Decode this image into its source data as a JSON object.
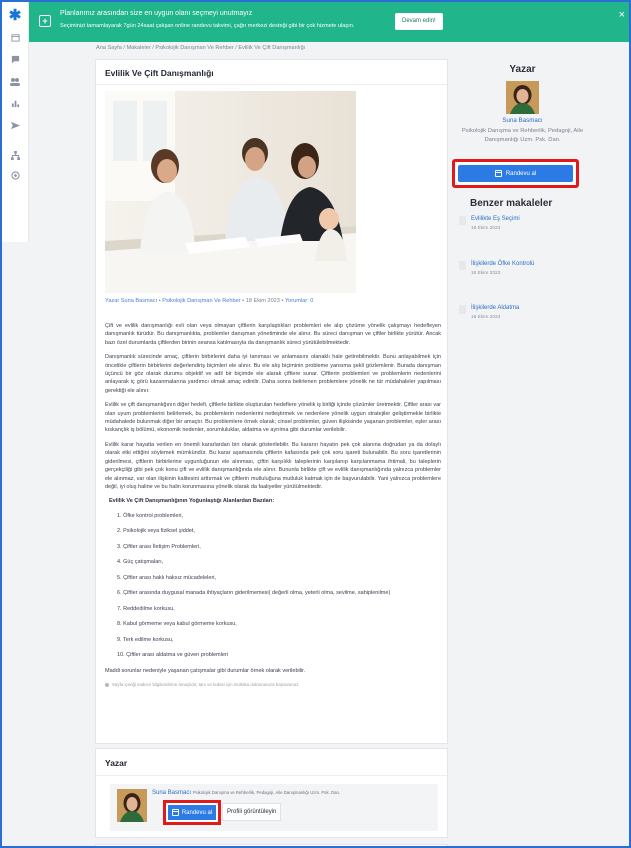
{
  "banner": {
    "title": "Planlarımız arasından size en uygun olanı seçmeyi unutmayız",
    "subtitle": "Seçiminizi tamamlayarak 7gün 24saat çalışan online randevu takvimi, çağrı merkezi desteği gibi bir çok hizmete ulaşın.",
    "cta": "Devam edin!",
    "close": "×",
    "color": "#20b58a"
  },
  "sidebar": {
    "icons": [
      "asterisk-logo-icon",
      "calendar-icon",
      "chat-icon",
      "users-icon",
      "bar-chart-icon",
      "send-icon",
      "org-chart-icon",
      "badge-icon"
    ]
  },
  "breadcrumb": "Ana Sayfa / Makaleler / Psikolojik Danışman Ve Rehber / Evlilik Ve Çift Danışmanlığı",
  "article": {
    "title": "Evlilik Ve Çift Danışmanlığı",
    "meta": {
      "prefix": "Yazar",
      "author": "Suna Basmacı",
      "category": "Psikolojik Danışman Ve Rehber",
      "date": "18 Ekim 2023",
      "comments": "Yorumlar: 0"
    },
    "paragraphs": [
      "Çift ve evlilik danışmanlığı evli olan veya olmayan çiftlerin karşılaştıkları problemleri ele alıp çözüme yönelik çalışmayı hedefleyen danışmanlık türüdür. Bu danışmanlıkta, problemler danışman yönetiminde ele alınır. Bu süreci danışman ve çiftler birlikte yürütür. Ancak bazı özel durumlarda çiftlerden birinin seansa katılmasıyla da danışmanlık süreci yürütülebilmektedir.",
      "Danışmanlık sürecinde amaç, çiftlerin birbirlerini daha iyi tanıması ve anlamasını olanaklı hale getirebilmektir. Bunu anlayabilmek için öncelikle çiftlerin birbirlerini değerlendiriş biçimleri ele alınır. Bu ele alış biçiminin probleme yansıma şekli gözlemlenir. Burada danışman üçüncü bir göz olarak durumu objektif ve adil bir biçimde ele alarak çiftlere sunar. Çiftlerin problemleri ve problemlerin nedenlerini anlayarak iç görü kazanmalarına yardımcı olmak amaç edinilir. Daha sonra belirlenen problemlere yönelik ne tür müdahaleler yapılması gerektiği ele alınır.",
      "Evlilik ve çift danışmanlığının diğer hedefi, çiftlerle birlikte oluşturulan hedeflere yönelik iş birliği içinde çözümler üretmektir. Çiftler arası var olan uyum problemlerini belirlemek, bu problemlerin nedenlerini netleştirmek ve nedenlere yönelik uygun stratejiler geliştirmekle birlikte müdahalede bulunmak diğer bir amaçtır. Bu problemlere örnek olarak; cinsel problemler, güven ilişkisinde yaşanan problemler, eşler arası kıskançlık iş bölümü, ekonomik nedenler, sorumluluklar, aldatma ve ayrılma gibi durumlar verilebilir.",
      "Evlilik karar hayatta verilen en önemli kararlardan biri olarak gösterilebilir. Bu kararın hayatın pek çok alanına doğrudan ya da dolaylı olarak etki ettiğini söylemek mümkündür. Bu karar aşamasında çiftlerin kafasında pek çok soru işareti bulunabilir. Bu soru işaretlerinin giderilmesi, çiftlerin birbirlerine uygunluğunun ele alınması, çiftin karşılıklı taleplerinin karşılanıp karşılanmama ihtimali, bu taleplerin gerçekçiliği gibi pek çok konu çift ve evlilik danışmanlığında ele alınır. Bununla birlikte çift ve evlilik danışmanlığında yalnızca problemler ele alınmaz, var olan ilişkinin kalitesini arttırmak ve çiftlerin mutluluğuna mutluluk katmak için de başvurulabilir. Yani yalnızca problemlere değil, iyi oluş haline ve bu halin korunmasına yönelik olarak da faaliyetler yürütülmektedir."
    ],
    "list_heading": "Evlilik Ve Çift Danışmanlığının Yoğunlaştığı Alanlardan Bazıları:",
    "list_items": [
      "1. Öfke kontrol problemleri,",
      "2. Psikolojik veya fiziksel şiddet,",
      "3. Çiftler arası İletişim Problemleri,",
      "4. Güç çatışmaları,",
      "5. Çiftler arası haklı haksız mücadeleleri,",
      "6. Çiftler arasında duygusal manada ihtiyaçların giderilmemesi( değerli olma, yeterli olma, sevilme, sahiplenilme)",
      "7. Reddedilme korkusu,",
      "8. Kabul görmeme veya kabul görmeme korkusu,",
      "9. Terk edilme korkusu,",
      "10. Çiftler arası aldatma ve güven problemleri"
    ],
    "closing": "Maddi sorunlar nedeniyle yaşanan çatışmalar gibi durumlar örnek olarak verilebilir.",
    "note": "Sayfa içeriği sadece bilgilendirme amaçlıdır, tanı ve tedavi için mutlaka doktorunuza başvurunuz."
  },
  "author_sidebar": {
    "heading": "Yazar",
    "name": "Suna Basmacı",
    "description": "Psikolojik Danışma ve Rehberlik, Pedagoji, Aile Danışmanlığı Uzm. Psk. Dan.",
    "button": "Randevu al"
  },
  "related": {
    "heading": "Benzer makaleler",
    "items": [
      {
        "title": "Evlilikte Eş Seçimi",
        "date": "18 Ekim 2023"
      },
      {
        "title": "İlişkilerde Öfke Kontrolü",
        "date": "18 Ekim 2023"
      },
      {
        "title": "İlişkilerde Aldatma",
        "date": "18 Ekim 2023"
      }
    ]
  },
  "author_bottom": {
    "heading": "Yazar",
    "name": "Suna Basmacı",
    "description": "Psikolojik Danışma ve Rehberlik, Pedagoji, Aile Danışmanlığı Uzm. Psk. Dan.",
    "button": "Randevu al",
    "profile_button": "Profili görüntüleyin"
  },
  "colors": {
    "accent": "#2c7be5",
    "highlight": "#e01a1a",
    "banner": "#20b58a"
  }
}
